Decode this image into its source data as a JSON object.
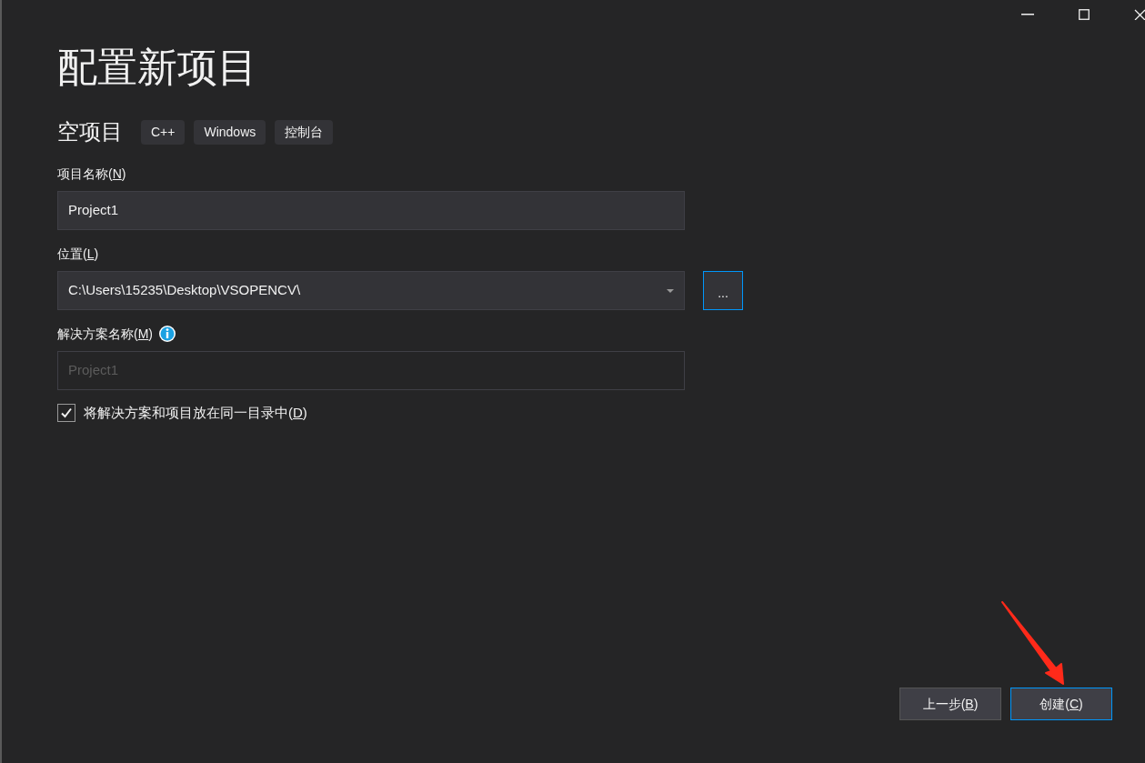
{
  "title": "配置新项目",
  "template": {
    "name": "空项目",
    "tags": [
      "C++",
      "Windows",
      "控制台"
    ]
  },
  "fields": [
    {
      "kind": "text",
      "label": "项目名称(N)",
      "value": "Project1",
      "disabled": false,
      "info": false
    },
    {
      "kind": "dropdown",
      "label": "位置(L)",
      "value": "C:\\Users\\15235\\Desktop\\VSOPENCV\\",
      "disabled": false,
      "info": false,
      "browse": "..."
    },
    {
      "kind": "text",
      "label": "解决方案名称(M)",
      "value": "Project1",
      "disabled": true,
      "info": true
    }
  ],
  "same_directory": {
    "label": "将解决方案和项目放在同一目录中(D)",
    "checked": true
  },
  "buttons": [
    {
      "label": "上一步(B)",
      "focused": false
    },
    {
      "label": "创建(C)",
      "focused": true
    }
  ]
}
